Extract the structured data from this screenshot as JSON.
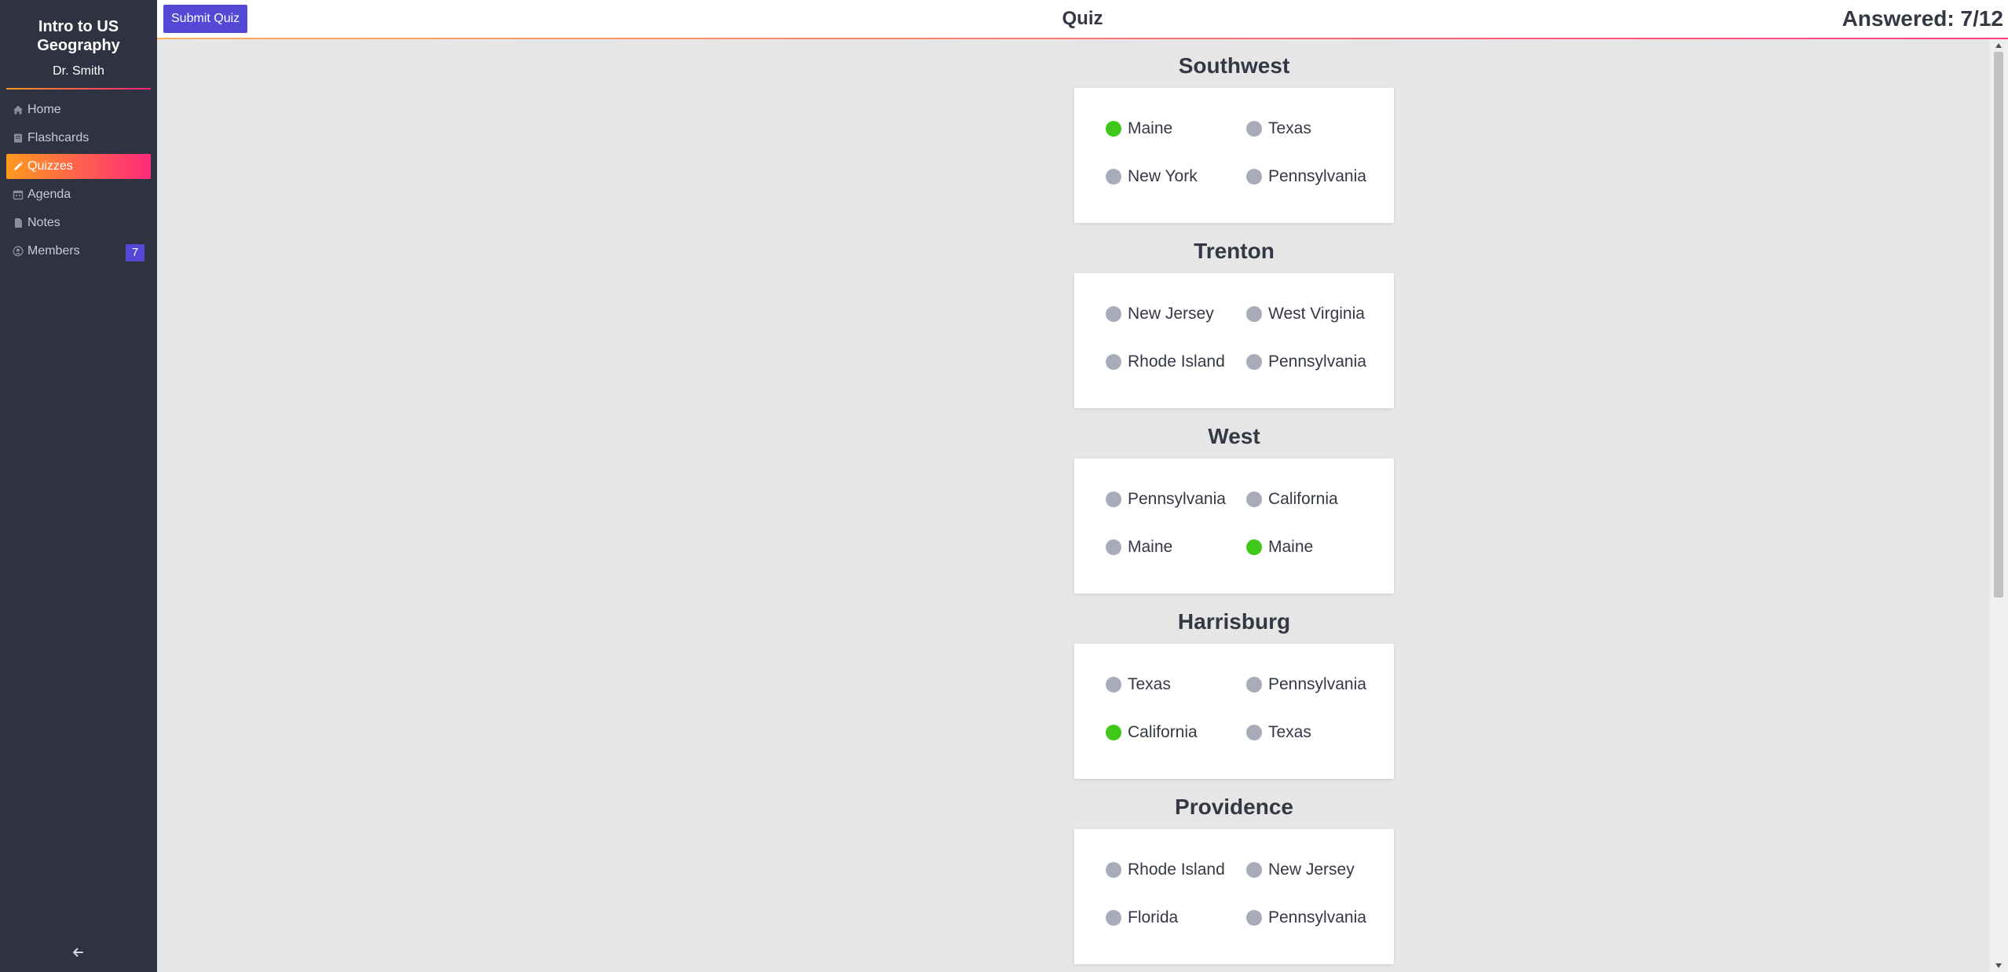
{
  "sidebar": {
    "course_title": "Intro to US Geography",
    "instructor": "Dr. Smith",
    "items": [
      {
        "label": "Home",
        "icon": "home-icon",
        "active": false
      },
      {
        "label": "Flashcards",
        "icon": "flashcards-icon",
        "active": false
      },
      {
        "label": "Quizzes",
        "icon": "pencil-icon",
        "active": true
      },
      {
        "label": "Agenda",
        "icon": "calendar-icon",
        "active": false
      },
      {
        "label": "Notes",
        "icon": "document-icon",
        "active": false
      },
      {
        "label": "Members",
        "icon": "user-circle-icon",
        "active": false,
        "badge": "7"
      }
    ],
    "collapse_icon": "arrow-left-icon"
  },
  "topbar": {
    "submit_label": "Submit Quiz",
    "title": "Quiz",
    "answered": "Answered: 7/12"
  },
  "questions": [
    {
      "title": "Southwest",
      "options": [
        {
          "label": "Maine",
          "selected": true
        },
        {
          "label": "Texas",
          "selected": false
        },
        {
          "label": "New York",
          "selected": false
        },
        {
          "label": "Pennsylvania",
          "selected": false
        }
      ]
    },
    {
      "title": "Trenton",
      "options": [
        {
          "label": "New Jersey",
          "selected": false
        },
        {
          "label": "West Virginia",
          "selected": false
        },
        {
          "label": "Rhode Island",
          "selected": false
        },
        {
          "label": "Pennsylvania",
          "selected": false
        }
      ]
    },
    {
      "title": "West",
      "options": [
        {
          "label": "Pennsylvania",
          "selected": false
        },
        {
          "label": "California",
          "selected": false
        },
        {
          "label": "Maine",
          "selected": false
        },
        {
          "label": "Maine",
          "selected": true
        }
      ]
    },
    {
      "title": "Harrisburg",
      "options": [
        {
          "label": "Texas",
          "selected": false
        },
        {
          "label": "Pennsylvania",
          "selected": false
        },
        {
          "label": "California",
          "selected": true
        },
        {
          "label": "Texas",
          "selected": false
        }
      ]
    },
    {
      "title": "Providence",
      "options": [
        {
          "label": "Rhode Island",
          "selected": false
        },
        {
          "label": "New Jersey",
          "selected": false
        },
        {
          "label": "Florida",
          "selected": false
        },
        {
          "label": "Pennsylvania",
          "selected": false
        }
      ]
    }
  ],
  "colors": {
    "accent": "#5449d6",
    "selected": "#3fc81a",
    "unselected": "#a8abba",
    "sidebar_bg": "#2f3240",
    "gradient_start": "#ff9a1f",
    "gradient_end": "#ff2a7a"
  }
}
